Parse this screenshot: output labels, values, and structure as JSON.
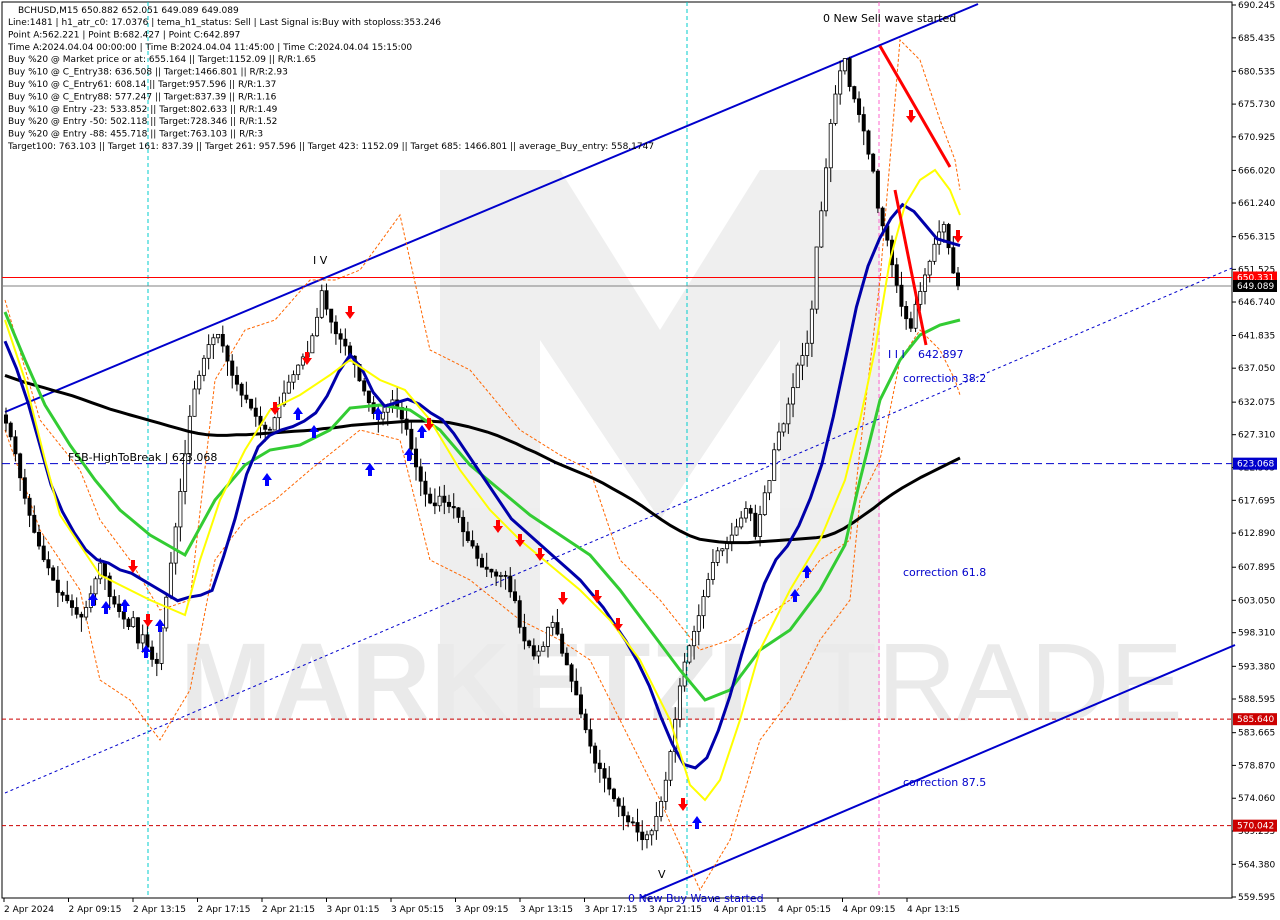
{
  "chart_data": {
    "type": "candlestick",
    "title": "BCHUSD,M15  650.882 652.051 649.089 649.089",
    "info_lines": [
      "Line:1481  |  h1_atr_c0: 17.0376  |  tema_h1_status: Sell  |  Last Signal is:Buy with stoploss:353.246",
      "Point A:562.221  |  Point B:682.427  |  Point C:642.897",
      "Time A:2024.04.04 00:00:00  |  Time B:2024.04.04 11:45:00  |  Time C:2024.04.04 15:15:00",
      "Buy %20 @ Market price or at: 655.164  ||  Target:1152.09  ||  R/R:1.65",
      "Buy %10 @ C_Entry38: 636.508  ||  Target:1466.801  ||  R/R:2.93",
      "Buy %10 @ C_Entry61: 608.14  ||  Target:957.596  ||  R/R:1.37",
      "Buy %10 @ C_Entry88: 577.247  ||  Target:837.39  ||  R/R:1.16",
      "Buy %10 @ Entry -23: 533.852  ||  Target:802.633  ||  R/R:1.49",
      "Buy %20 @ Entry -50: 502.118  ||  Target:728.346  ||  R/R:1.52",
      "Buy %20 @ Entry -88: 455.718  ||  Target:763.103  ||  R/R:3",
      "Target100: 763.103  ||  Target 161: 837.39  ||  Target 261: 957.596  ||  Target 423: 1152.09  ||  Target 685: 1466.801  ||  average_Buy_entry: 558.1747"
    ],
    "y_ticks": [
      "690.245",
      "685.435",
      "680.535",
      "675.730",
      "670.925",
      "666.020",
      "661.240",
      "656.315",
      "651.525",
      "646.740",
      "641.835",
      "637.050",
      "632.075",
      "627.310",
      "622.505",
      "617.695",
      "612.890",
      "607.895",
      "603.050",
      "598.310",
      "593.380",
      "588.595",
      "583.665",
      "578.870",
      "574.060",
      "569.255",
      "564.380",
      "559.595"
    ],
    "x_ticks": [
      "2 Apr 2024",
      "2 Apr 09:15",
      "2 Apr 13:15",
      "2 Apr 17:15",
      "2 Apr 21:15",
      "3 Apr 01:15",
      "3 Apr 05:15",
      "3 Apr 09:15",
      "3 Apr 13:15",
      "3 Apr 17:15",
      "3 Apr 21:15",
      "4 Apr 01:15",
      "4 Apr 05:15",
      "4 Apr 09:15",
      "4 Apr 13:15"
    ],
    "ylim": [
      559.595,
      690.245
    ],
    "price_labels": [
      {
        "text": "650.331",
        "value": 650.331,
        "color": "#ff0000"
      },
      {
        "text": "649.089",
        "value": 649.089,
        "color": "#000000"
      },
      {
        "text": "623.068",
        "value": 623.068,
        "color": "#0000cc"
      },
      {
        "text": "585.640",
        "value": 585.64,
        "color": "#cc0000"
      },
      {
        "text": "570.042",
        "value": 570.042,
        "color": "#cc0000"
      }
    ],
    "annotations": {
      "new_sell_wave": "0 New Sell wave started",
      "new_buy_wave": "0 New Buy Wave started",
      "fsb_label": "FSB-HighToBreak | 623.068",
      "point_c_value": "642.897",
      "point_c_marks": "I I I",
      "wave_mark_v": "V",
      "wave_mark_iv": "I V",
      "corrections": [
        "correction 38.2",
        "correction 61.8",
        "correction 87.5"
      ]
    },
    "series_close": [
      629.0,
      627.0,
      624.5,
      621.0,
      618.0,
      615.5,
      613.0,
      611.0,
      609.0,
      607.8,
      606.0,
      604.2,
      603.8,
      603.0,
      602.0,
      601.0,
      600.6,
      602.0,
      604.0,
      606.2,
      608.5,
      606.6,
      603.6,
      602.5,
      601.4,
      600.3,
      599.2,
      600.5,
      596.8,
      598.0,
      596.2,
      594.4,
      593.8,
      599.0,
      603.5,
      608.5,
      613.8,
      619.0,
      624.5,
      630.0,
      634.0,
      636.0,
      638.5,
      640.5,
      641.5,
      642.0,
      640.3,
      638.1,
      636.0,
      634.7,
      633.1,
      632.5,
      631.2,
      630.0,
      628.7,
      628.1,
      628.0,
      629.8,
      631.7,
      633.4,
      635.0,
      636.1,
      637.5,
      638.7,
      639.3,
      641.8,
      644.5,
      648.4,
      645.7,
      643.8,
      642.1,
      641.3,
      640.3,
      638.8,
      637.6,
      635.2,
      633.7,
      632.0,
      630.4,
      629.6,
      630.6,
      631.6,
      632.4,
      631.3,
      629.6,
      628.1,
      625.2,
      622.6,
      620.5,
      618.6,
      617.3,
      616.9,
      618.3,
      617.4,
      616.8,
      616.6,
      615.2,
      613.1,
      611.8,
      611.0,
      609.2,
      607.9,
      607.6,
      607.2,
      606.6,
      606.7,
      606.6,
      604.3,
      603.0,
      599.1,
      597.1,
      596.4,
      594.9,
      595.6,
      596.3,
      599.1,
      599.8,
      598.1,
      595.3,
      593.6,
      591.2,
      589.2,
      586.4,
      584.1,
      581.7,
      579.2,
      578.4,
      577.0,
      575.4,
      574.0,
      572.9,
      571.5,
      570.6,
      570.5,
      569.1,
      568.0,
      568.7,
      569.3,
      571.4,
      573.6,
      576.7,
      580.9,
      585.6,
      590.5,
      594.0,
      596.4,
      598.5,
      600.8,
      603.6,
      606.1,
      608.6,
      610.3,
      610.6,
      611.6,
      612.6,
      613.8,
      615.1,
      616.5,
      615.8,
      612.4,
      615.6,
      618.8,
      620.6,
      625.1,
      627.7,
      628.9,
      631.8,
      634.2,
      637.5,
      638.9,
      640.7,
      645.7,
      654.8,
      660.1,
      666.4,
      672.9,
      677.2,
      680.6,
      682.4,
      678.3,
      676.5,
      674.2,
      671.8,
      668.4,
      665.9,
      660.5,
      657.9,
      655.8,
      652.2,
      649.2,
      646.1,
      644.3,
      642.9,
      646.4,
      648.3,
      650.7,
      652.7,
      655.2,
      657.0,
      658.1,
      654.7,
      651.0,
      649.1
    ],
    "ma_black": [
      636.0,
      635.5,
      635.0,
      634.6,
      634.2,
      633.8,
      633.4,
      633.0,
      632.5,
      632.0,
      631.5,
      631.0,
      630.6,
      630.2,
      629.8,
      629.4,
      629.0,
      628.6,
      628.2,
      627.8,
      627.5,
      627.3,
      627.2,
      627.2,
      627.3,
      627.3,
      627.4,
      627.5,
      627.6,
      627.7,
      627.8,
      627.9,
      628.0,
      628.2,
      628.3,
      628.5,
      628.7,
      628.8,
      628.9,
      629.0,
      629.1,
      629.2,
      629.3,
      629.3,
      629.3,
      629.2,
      629.1,
      628.8,
      628.5,
      628.1,
      627.7,
      627.2,
      626.6,
      626.0,
      625.3,
      624.7,
      624.0,
      623.3,
      622.7,
      622.1,
      621.5,
      620.9,
      620.2,
      619.4,
      618.6,
      617.8,
      616.9,
      615.9,
      614.9,
      614.0,
      613.2,
      612.5,
      612.0,
      611.8,
      611.6,
      611.5,
      611.5,
      611.5,
      611.6,
      611.7,
      611.8,
      611.9,
      612.0,
      612.1,
      612.2,
      612.4,
      612.9,
      613.6,
      614.5,
      615.5,
      616.5,
      617.6,
      618.6,
      619.5,
      620.3,
      621.1,
      621.8,
      622.5,
      623.2,
      623.9
    ],
    "ma_blue": [
      641.0,
      637.0,
      632.0,
      626.0,
      620.0,
      616.0,
      613.0,
      610.5,
      609.0,
      608.5,
      607.5,
      607.0,
      606.0,
      605.0,
      604.0,
      603.0,
      603.5,
      603.8,
      604.5,
      609.5,
      615.0,
      621.5,
      625.5,
      627.2,
      628.0,
      628.5,
      629.3,
      630.5,
      633.0,
      636.5,
      639.0,
      637.0,
      633.5,
      631.5,
      632.0,
      632.5,
      631.8,
      630.5,
      629.5,
      627.5,
      625.0,
      622.5,
      620.0,
      617.5,
      615.0,
      613.5,
      612.0,
      610.5,
      609.0,
      607.5,
      606.0,
      604.0,
      602.0,
      599.5,
      597.0,
      594.0,
      590.5,
      586.0,
      582.0,
      579.0,
      578.5,
      580.0,
      584.0,
      589.0,
      595.0,
      600.5,
      605.5,
      609.0,
      611.0,
      614.0,
      618.0,
      623.0,
      630.0,
      638.0,
      646.0,
      652.0,
      656.0,
      659.0,
      661.0,
      660.0,
      658.0,
      656.0,
      655.5,
      655.0
    ]
  }
}
